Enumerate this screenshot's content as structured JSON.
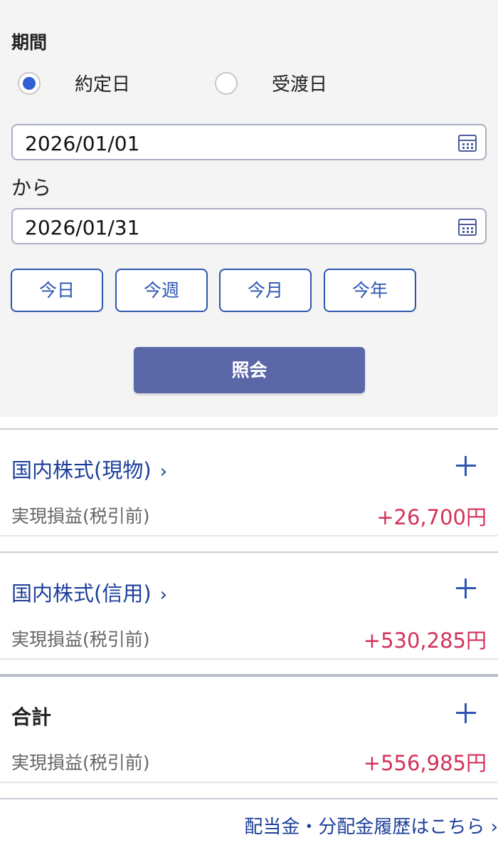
{
  "filter": {
    "period_label": "期間",
    "radio_options": [
      {
        "label": "約定日",
        "checked": true
      },
      {
        "label": "受渡日",
        "checked": false
      }
    ],
    "start_date": "2026/01/01",
    "separator": "から",
    "end_date": "2026/01/31",
    "quick_buttons": [
      "今日",
      "今週",
      "今月",
      "今年"
    ],
    "query_button": "照会"
  },
  "sections": [
    {
      "title": "国内株式(現物)",
      "chevron": "›",
      "pl_label": "実現損益(税引前)",
      "pl_value": "+26,700円"
    },
    {
      "title": "国内株式(信用)",
      "chevron": "›",
      "pl_label": "実現損益(税引前)",
      "pl_value": "+530,285円"
    }
  ],
  "total": {
    "title": "合計",
    "pl_label": "実現損益(税引前)",
    "pl_value": "+556,985円"
  },
  "dividend_link": "配当金・分配金履歴はこちら ›",
  "colors": {
    "accent": "#2d56b0",
    "profit": "#d2335a",
    "button": "#5b68a8"
  }
}
